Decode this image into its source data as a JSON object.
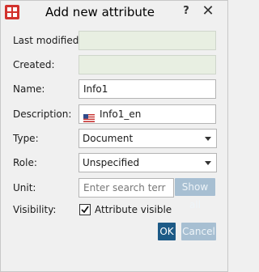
{
  "window": {
    "title": "Add new attribute",
    "help_label": "?",
    "close_label": "✕",
    "app_icon": "attribute-app-icon"
  },
  "form": {
    "last_modified": {
      "label": "Last modified:",
      "value": ""
    },
    "created": {
      "label": "Created:",
      "value": ""
    },
    "name": {
      "label": "Name:",
      "value": "Info1"
    },
    "description": {
      "label": "Description:",
      "value": "Info1_en",
      "flag_icon": "us-flag-icon"
    },
    "type": {
      "label": "Type:",
      "value": "Document"
    },
    "role": {
      "label": "Role:",
      "value": "Unspecified"
    },
    "unit": {
      "label": "Unit:",
      "placeholder": "Enter search terr",
      "show_all_label": "Show all"
    },
    "visibility": {
      "label": "Visibility:",
      "checkbox_label": "Attribute visible",
      "checked": true
    }
  },
  "buttons": {
    "ok": "OK",
    "cancel": "Cancel"
  },
  "colors": {
    "primary_button": "#1d5a86",
    "disabled_button": "#a7bfd2",
    "disabled_field": "#e8efe2"
  }
}
